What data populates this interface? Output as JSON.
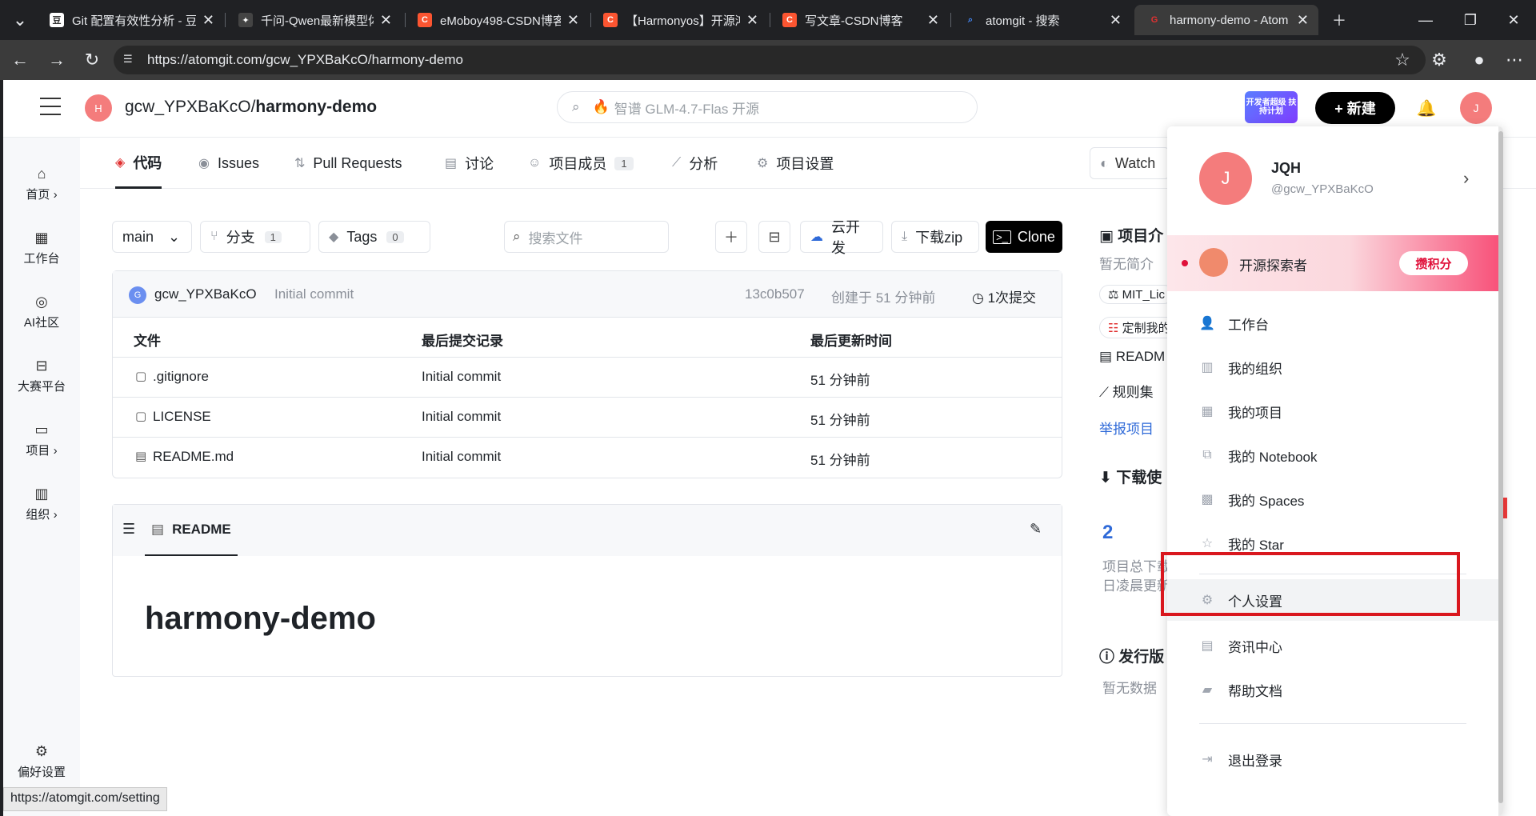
{
  "browser": {
    "tabs": [
      {
        "title": "Git 配置有效性分析 - 豆",
        "favicon_color": "#ffffff",
        "active": false
      },
      {
        "title": "千问-Qwen最新模型体验",
        "favicon_color": "#dddddd",
        "active": false
      },
      {
        "title": "eMoboy498-CSDN博客",
        "favicon_color": "#fc5531",
        "active": false
      },
      {
        "title": "【Harmonyos】开源鸿蒙",
        "favicon_color": "#fc5531",
        "active": false
      },
      {
        "title": "写文章-CSDN博客",
        "favicon_color": "#fc5531",
        "active": false
      },
      {
        "title": "atomgit - 搜索",
        "favicon_color": "#4285f4",
        "active": false
      },
      {
        "title": "harmony-demo - Atom",
        "favicon_color": "#e03131",
        "active": true
      }
    ],
    "url": "https://atomgit.com/gcw_YPXBaKcO/harmony-demo",
    "status_url": "https://atomgit.com/setting"
  },
  "header": {
    "repo_avatar_letter": "H",
    "repo_owner": "gcw_YPXBaKcO/",
    "repo_name": "harmony-demo",
    "search_placeholder": "智谱 GLM-4.7-Flas 开源",
    "badge_text": "开发者超级 扶持计划",
    "new_button": "+ 新建",
    "user_avatar_letter": "J"
  },
  "leftnav": [
    {
      "label": "首页 ›",
      "icon": "home-icon"
    },
    {
      "label": "工作台",
      "icon": "grid-icon"
    },
    {
      "label": "AI社区",
      "icon": "ai-icon"
    },
    {
      "label": "大赛平台",
      "icon": "trophy-icon"
    },
    {
      "label": "项目 ›",
      "icon": "folder-icon"
    },
    {
      "label": "组织 ›",
      "icon": "building-icon"
    },
    {
      "label": "偏好设置",
      "icon": "gear-icon"
    }
  ],
  "repo_tabs": [
    {
      "label": "代码",
      "icon": "code-icon",
      "active": true
    },
    {
      "label": "Issues",
      "icon": "issue-icon"
    },
    {
      "label": "Pull Requests",
      "icon": "pr-icon"
    },
    {
      "label": "讨论",
      "icon": "discussion-icon"
    },
    {
      "label": "项目成员",
      "icon": "members-icon",
      "count": "1"
    },
    {
      "label": "分析",
      "icon": "chart-icon"
    },
    {
      "label": "项目设置",
      "icon": "gear-icon"
    }
  ],
  "watch_label": "Watch",
  "toolbar": {
    "branch": "main",
    "branches_label": "分支",
    "branches_count": "1",
    "tags_label": "Tags",
    "tags_count": "0",
    "search_placeholder": "搜索文件",
    "cloud_dev": "云开发",
    "download_zip": "下载zip",
    "clone": "Clone"
  },
  "commit": {
    "author_avatar": "G",
    "author": "gcw_YPXBaKcO",
    "message": "Initial commit",
    "hash": "13c0b507",
    "created": "创建于 51 分钟前",
    "count": "1次提交"
  },
  "file_table": {
    "headers": [
      "文件",
      "最后提交记录",
      "最后更新时间"
    ],
    "rows": [
      {
        "name": ".gitignore",
        "commit": "Initial commit",
        "time": "51 分钟前"
      },
      {
        "name": "LICENSE",
        "commit": "Initial commit",
        "time": "51 分钟前"
      },
      {
        "name": "README.md",
        "commit": "Initial commit",
        "time": "51 分钟前"
      }
    ]
  },
  "readme": {
    "tab_label": "README",
    "title": "harmony-demo"
  },
  "sidebar_right": {
    "intro_title": "项目介",
    "intro_text": "暂无简介",
    "license": "MIT_Lic",
    "custom": "定制我的",
    "readme": "READM",
    "rules": "规则集",
    "report": "举报项目",
    "downloads_title": "下载使",
    "downloads_count": "2",
    "total_downloads": "项目总下载",
    "daily_update": "日凌晨更新",
    "releases_title": "发行版",
    "no_data": "暂无数据"
  },
  "dropdown": {
    "avatar_letter": "J",
    "name": "JQH",
    "handle": "@gcw_YPXBaKcO",
    "banner_text": "开源探索者",
    "banner_button": "攒积分",
    "items": [
      {
        "label": "工作台",
        "icon": "user-icon"
      },
      {
        "label": "我的组织",
        "icon": "org-icon"
      },
      {
        "label": "我的项目",
        "icon": "project-icon"
      },
      {
        "label": "我的 Notebook",
        "icon": "notebook-icon"
      },
      {
        "label": "我的 Spaces",
        "icon": "spaces-icon"
      },
      {
        "label": "我的 Star",
        "icon": "star-icon"
      },
      {
        "label": "个人设置",
        "icon": "gear-icon"
      },
      {
        "label": "资讯中心",
        "icon": "news-icon"
      },
      {
        "label": "帮助文档",
        "icon": "help-folder-icon"
      },
      {
        "label": "退出登录",
        "icon": "logout-icon"
      }
    ]
  },
  "colors": {
    "accent_red": "#e03131",
    "highlight": "#d9171e",
    "link_blue": "#2f6ad8"
  }
}
